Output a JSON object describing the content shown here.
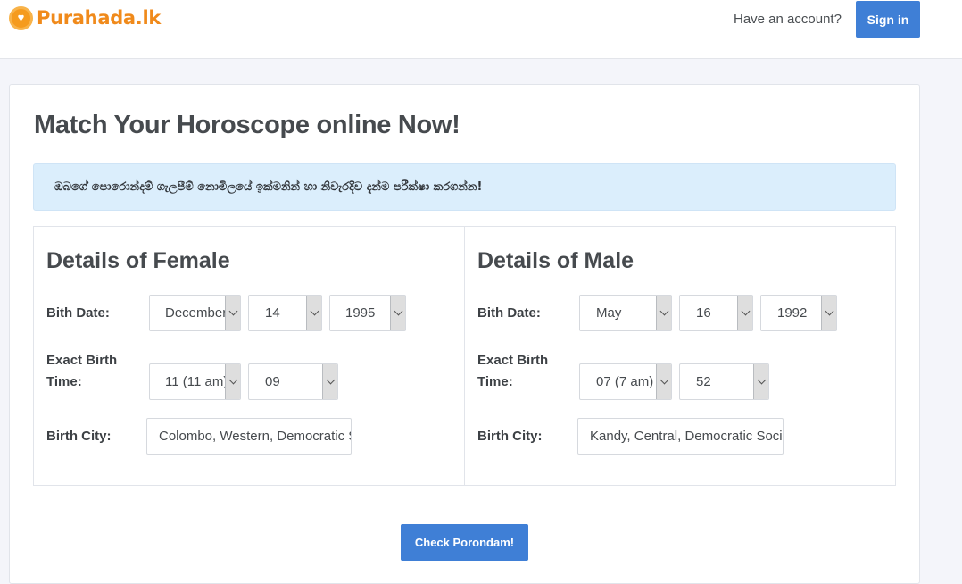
{
  "header": {
    "logo_text": "Purahada.lk",
    "have_account": "Have an account?",
    "sign_in": "Sign in"
  },
  "main": {
    "title": "Match Your Horoscope online Now!",
    "notice": "ඔබගේ පොරොන්දම් ගැලපීම් නොමිලයේ ඉක්මනින් හා නිවැරදිව දැන්ම පරීක්ෂා කරගන්න!"
  },
  "female": {
    "title": "Details of Female",
    "birth_date_label": "Bith Date:",
    "month": "December",
    "day": "14",
    "year": "1995",
    "birth_time_label_line1": "Exact Birth",
    "birth_time_label_line2": "Time:",
    "hour": "11 (11 am)",
    "minute": "09",
    "city_label": "Birth City:",
    "city": "Colombo, Western, Democratic Socialist Republic of Sri Lanka"
  },
  "male": {
    "title": "Details of Male",
    "birth_date_label": "Bith Date:",
    "month": "May",
    "day": "16",
    "year": "1992",
    "birth_time_label_line1": "Exact Birth",
    "birth_time_label_line2": "Time:",
    "hour": "07 (7 am)",
    "minute": "52",
    "city_label": "Birth City:",
    "city": "Kandy, Central, Democratic Socialist Republic of Sri Lanka"
  },
  "actions": {
    "check_button": "Check Porondam!"
  },
  "colors": {
    "primary_button": "#3f7fd6",
    "logo": "#f08a1b",
    "alert_bg": "#dbeefc"
  }
}
